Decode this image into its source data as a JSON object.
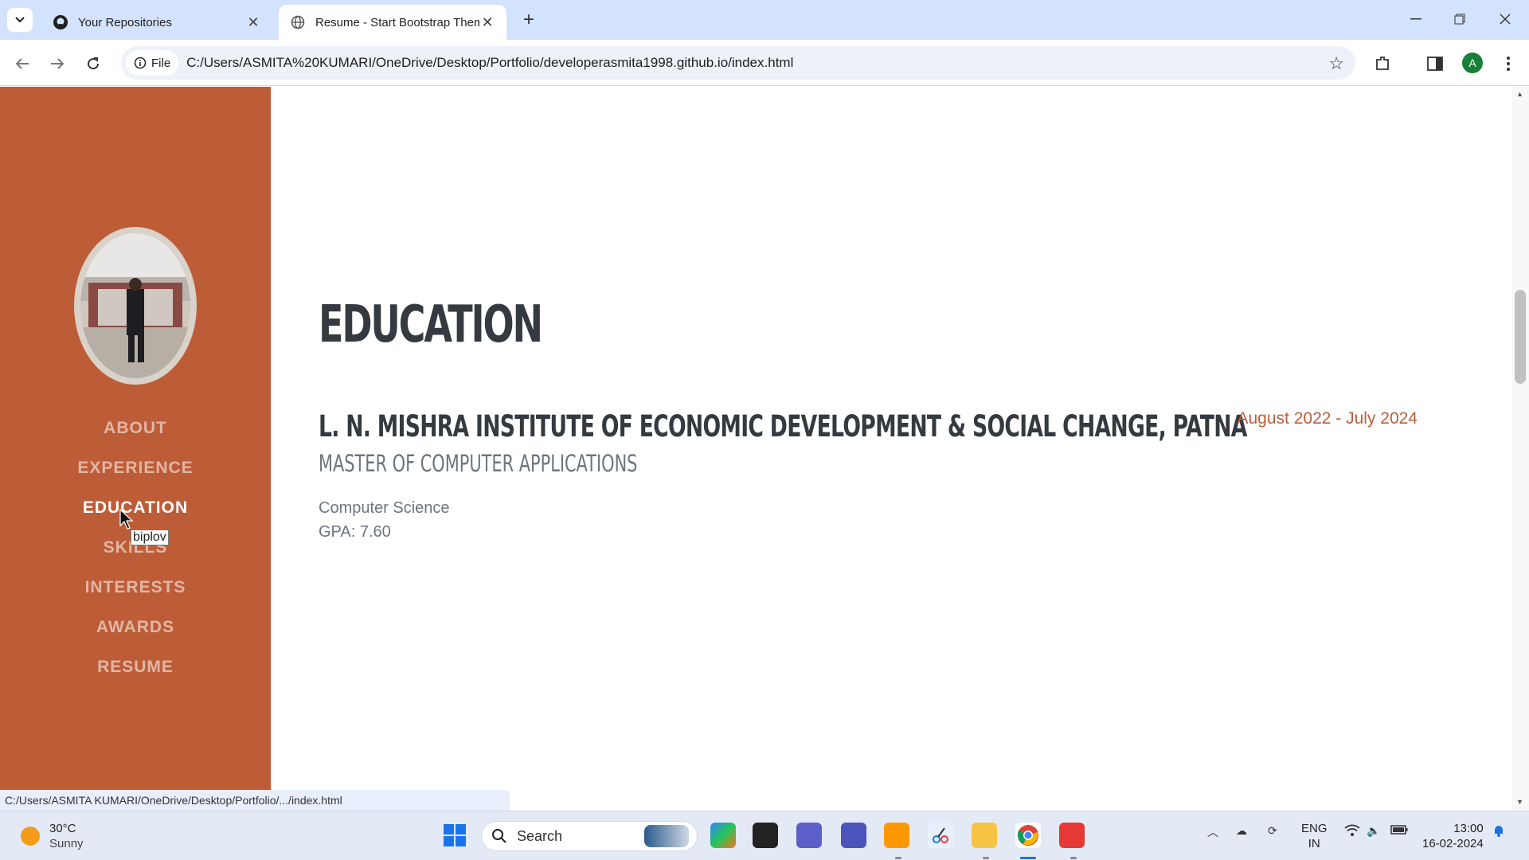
{
  "browser": {
    "tabs": [
      {
        "title": "Your Repositories",
        "active": false
      },
      {
        "title": "Resume - Start Bootstrap Theme",
        "active": true
      }
    ],
    "file_chip": "File",
    "url": "C:/Users/ASMITA%20KUMARI/OneDrive/Desktop/Portfolio/developerasmita1998.github.io/index.html",
    "profile_initial": "A",
    "status_url": "C:/Users/ASMITA KUMARI/OneDrive/Desktop/Portfolio/.../index.html"
  },
  "sidebar": {
    "nav": [
      {
        "label": "ABOUT",
        "active": false
      },
      {
        "label": "EXPERIENCE",
        "active": false
      },
      {
        "label": "EDUCATION",
        "active": true
      },
      {
        "label": "SKILLS",
        "active": false
      },
      {
        "label": "INTERESTS",
        "active": false
      },
      {
        "label": "AWARDS",
        "active": false
      },
      {
        "label": "RESUME",
        "active": false
      }
    ],
    "tooltip": "biplov"
  },
  "education": {
    "section_title": "EDUCATION",
    "entries": [
      {
        "institution": "L. N. MISHRA INSTITUTE OF ECONOMIC DEVELOPMENT & SOCIAL CHANGE, PATNA",
        "degree": "MASTER OF COMPUTER APPLICATIONS",
        "field": "Computer Science",
        "gpa": "GPA: 7.60",
        "dates": "August 2022 - July 2024"
      }
    ]
  },
  "taskbar": {
    "weather_temp": "30°C",
    "weather_cond": "Sunny",
    "search_label": "Search",
    "lang_top": "ENG",
    "lang_bottom": "IN",
    "time": "13:00",
    "date": "16-02-2024"
  },
  "colors": {
    "sidebar_bg": "#bd5d38",
    "heading": "#343a40",
    "muted": "#6c757d",
    "accent": "#bd5d38"
  }
}
